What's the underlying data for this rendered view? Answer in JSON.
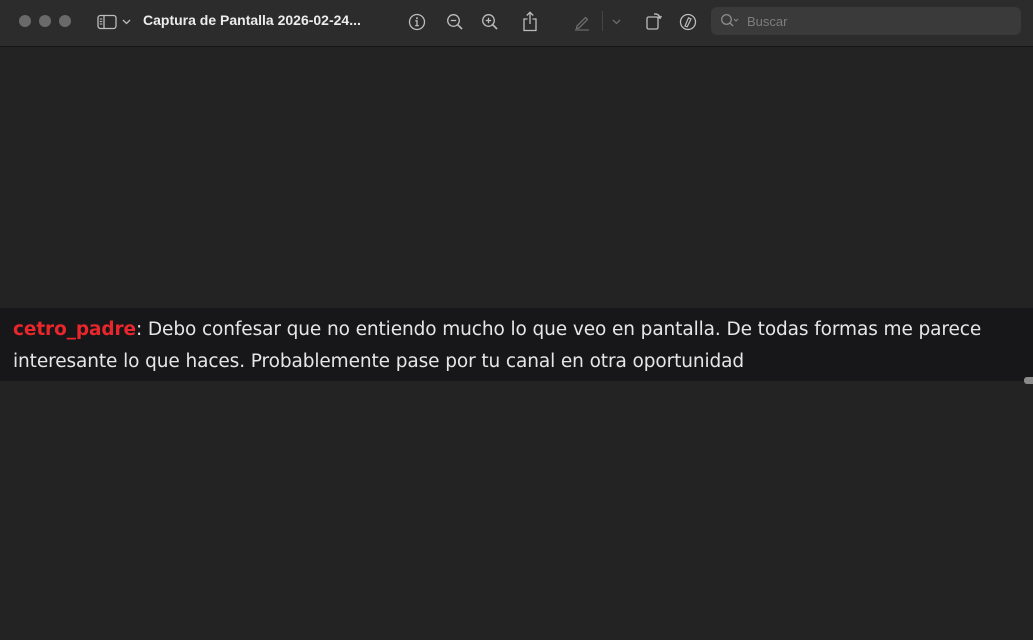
{
  "window": {
    "title": "Captura de Pantalla 2026-02-24..."
  },
  "toolbar": {
    "icons": [
      "sidebar-icon",
      "chevron-down-icon",
      "info-icon",
      "zoom-out-icon",
      "zoom-in-icon",
      "share-icon",
      "highlight-pen-icon",
      "chevron-down-icon",
      "rotate-icon",
      "markup-icon"
    ],
    "search": {
      "placeholder": "Buscar",
      "value": ""
    }
  },
  "chat": {
    "username": "cetro_padre",
    "separator": ":",
    "message": " Debo confesar que no entiendo mucho lo que veo en pantalla. De todas formas me parece interesante lo que haces. Probablemente pase por tu canal en otra oportunidad",
    "username_color": "#e8262b"
  }
}
